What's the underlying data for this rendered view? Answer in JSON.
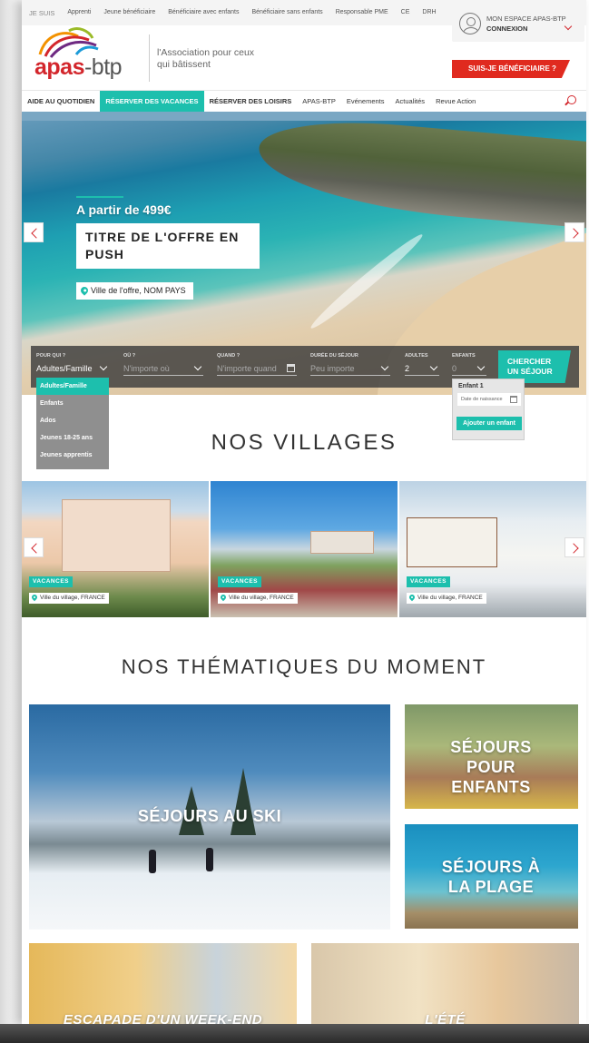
{
  "topbar": {
    "profiles": [
      "JE SUIS",
      "Apprenti",
      "Jeune bénéficiaire",
      "Bénéficiaire avec enfants",
      "Bénéficiaire sans enfants",
      "Responsable PME",
      "CE",
      "DRH"
    ],
    "account_title": "MON ESPACE APAS-BTP",
    "account_login": "CONNEXION"
  },
  "header": {
    "logo_brand": "apas",
    "logo_suffix": "-btp",
    "tagline": "l'Association pour ceux qui bâtissent",
    "cta_label": "SUIS-JE BÉNÉFICIAIRE ?"
  },
  "nav": {
    "items": [
      "AIDE AU QUOTIDIEN",
      "RÉSERVER DES VACANCES",
      "RÉSERVER DES LOISIRS",
      "APAS-BTP",
      "Evénements",
      "Actualités",
      "Revue Action"
    ],
    "active_index": 1
  },
  "hero": {
    "price": "A partir de 499€",
    "title": "TITRE DE L'OFFRE EN PUSH",
    "location": "Ville de l'offre, NOM PAYS"
  },
  "search": {
    "for_who_label": "POUR QUI ?",
    "for_who_value": "Adultes/Famille",
    "where_label": "OÙ ?",
    "where_placeholder": "N'importe où",
    "when_label": "QUAND ?",
    "when_placeholder": "N'importe quand",
    "duration_label": "DURÉE DU SÉJOUR",
    "duration_placeholder": "Peu importe",
    "adults_label": "ADULTES",
    "adults_value": "2",
    "children_label": "ENFANTS",
    "children_value": "0",
    "button_label": "CHERCHER UN SÉJOUR"
  },
  "dropdown": {
    "options": [
      "Adultes/Famille",
      "Enfants",
      "Ados",
      "Jeunes 18-25 ans",
      "Jeunes apprentis"
    ],
    "selected_index": 0
  },
  "child_popup": {
    "label": "Enfant 1",
    "date_placeholder": "Date de naissance",
    "add_label": "Ajouter un enfant"
  },
  "villages": {
    "title": "NOS VILLAGES",
    "cards": [
      {
        "badge": "VACANCES",
        "location": "Ville du village, FRANCE"
      },
      {
        "badge": "VACANCES",
        "location": "Ville du village, FRANCE"
      },
      {
        "badge": "VACANCES",
        "location": "Ville du village, FRANCE"
      }
    ]
  },
  "thematiques": {
    "title": "NOS THÉMATIQUES DU MOMENT",
    "tiles": [
      "SÉJOURS AU SKI",
      "SÉJOURS POUR ENFANTS",
      "SÉJOURS À LA PLAGE",
      "ESCAPADE D'UN WEEK-END",
      "L'ÉTÉ"
    ]
  },
  "colors": {
    "accent": "#1dbfad",
    "brand_red": "#d3262c",
    "cta_red": "#e02a1f"
  }
}
